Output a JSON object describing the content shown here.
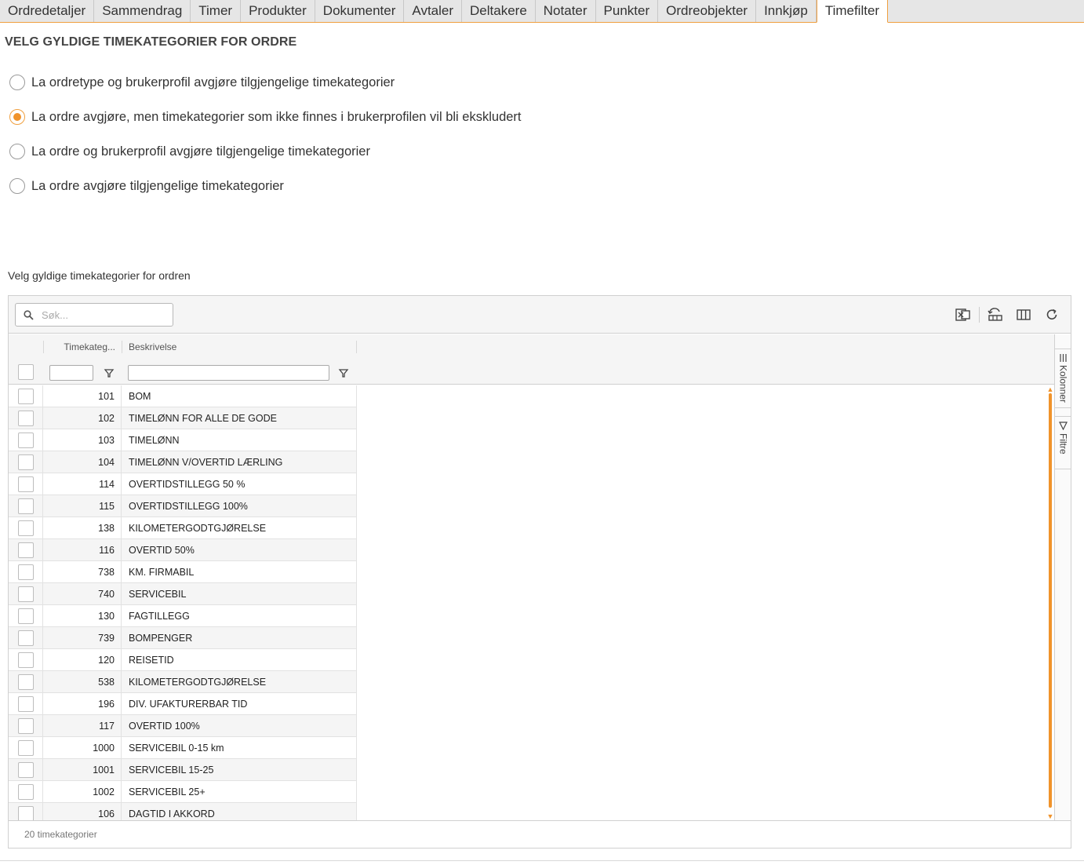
{
  "tabs": [
    {
      "label": "Ordredetaljer",
      "active": false
    },
    {
      "label": "Sammendrag",
      "active": false
    },
    {
      "label": "Timer",
      "active": false
    },
    {
      "label": "Produkter",
      "active": false
    },
    {
      "label": "Dokumenter",
      "active": false
    },
    {
      "label": "Avtaler",
      "active": false
    },
    {
      "label": "Deltakere",
      "active": false
    },
    {
      "label": "Notater",
      "active": false
    },
    {
      "label": "Punkter",
      "active": false
    },
    {
      "label": "Ordreobjekter",
      "active": false
    },
    {
      "label": "Innkjøp",
      "active": false
    },
    {
      "label": "Timefilter",
      "active": true
    }
  ],
  "section_title": "VELG GYLDIGE TIMEKATEGORIER FOR ORDRE",
  "options": [
    {
      "label": "La ordretype og brukerprofil avgjøre tilgjengelige timekategorier",
      "checked": false
    },
    {
      "label": "La ordre avgjøre, men timekategorier som ikke finnes i brukerprofilen vil bli ekskludert",
      "checked": true
    },
    {
      "label": "La ordre og brukerprofil avgjøre tilgjengelige timekategorier",
      "checked": false
    },
    {
      "label": "La ordre avgjøre tilgjengelige timekategorier",
      "checked": false
    }
  ],
  "grid_label": "Velg gyldige timekategorier for ordren",
  "grid": {
    "search_placeholder": "Søk...",
    "toolbar_icons": [
      "excel-export-icon",
      "reset-layout-icon",
      "columns-icon",
      "refresh-icon"
    ],
    "columns": [
      {
        "label": "Timekateg..."
      },
      {
        "label": "Beskrivelse"
      }
    ],
    "rows": [
      {
        "id": "101",
        "desc": "BOM"
      },
      {
        "id": "102",
        "desc": "TIMELØNN FOR ALLE DE GODE"
      },
      {
        "id": "103",
        "desc": "TIMELØNN"
      },
      {
        "id": "104",
        "desc": "TIMELØNN V/OVERTID LÆRLING"
      },
      {
        "id": "114",
        "desc": "OVERTIDSTILLEGG 50 %"
      },
      {
        "id": "115",
        "desc": "OVERTIDSTILLEGG 100%"
      },
      {
        "id": "138",
        "desc": "KILOMETERGODTGJØRELSE"
      },
      {
        "id": "116",
        "desc": "OVERTID 50%"
      },
      {
        "id": "738",
        "desc": "KM. FIRMABIL"
      },
      {
        "id": "740",
        "desc": "SERVICEBIL"
      },
      {
        "id": "130",
        "desc": "FAGTILLEGG"
      },
      {
        "id": "739",
        "desc": "BOMPENGER"
      },
      {
        "id": "120",
        "desc": "REISETID"
      },
      {
        "id": "538",
        "desc": "KILOMETERGODTGJØRELSE"
      },
      {
        "id": "196",
        "desc": "DIV. UFAKTURERBAR TID"
      },
      {
        "id": "117",
        "desc": "OVERTID 100%"
      },
      {
        "id": "1000",
        "desc": "SERVICEBIL 0-15 km"
      },
      {
        "id": "1001",
        "desc": "SERVICEBIL 15-25"
      },
      {
        "id": "1002",
        "desc": "SERVICEBIL 25+"
      },
      {
        "id": "106",
        "desc": "DAGTID I AKKORD"
      }
    ],
    "side_tabs": [
      {
        "label": "Kolonner",
        "icon": "columns-list-icon"
      },
      {
        "label": "Filtre",
        "icon": "filter-icon"
      }
    ],
    "footer": "20 timekategorier"
  },
  "colors": {
    "accent": "#f0932b",
    "tab_bg": "#e6e6e6",
    "row_alt": "#f5f5f5"
  }
}
